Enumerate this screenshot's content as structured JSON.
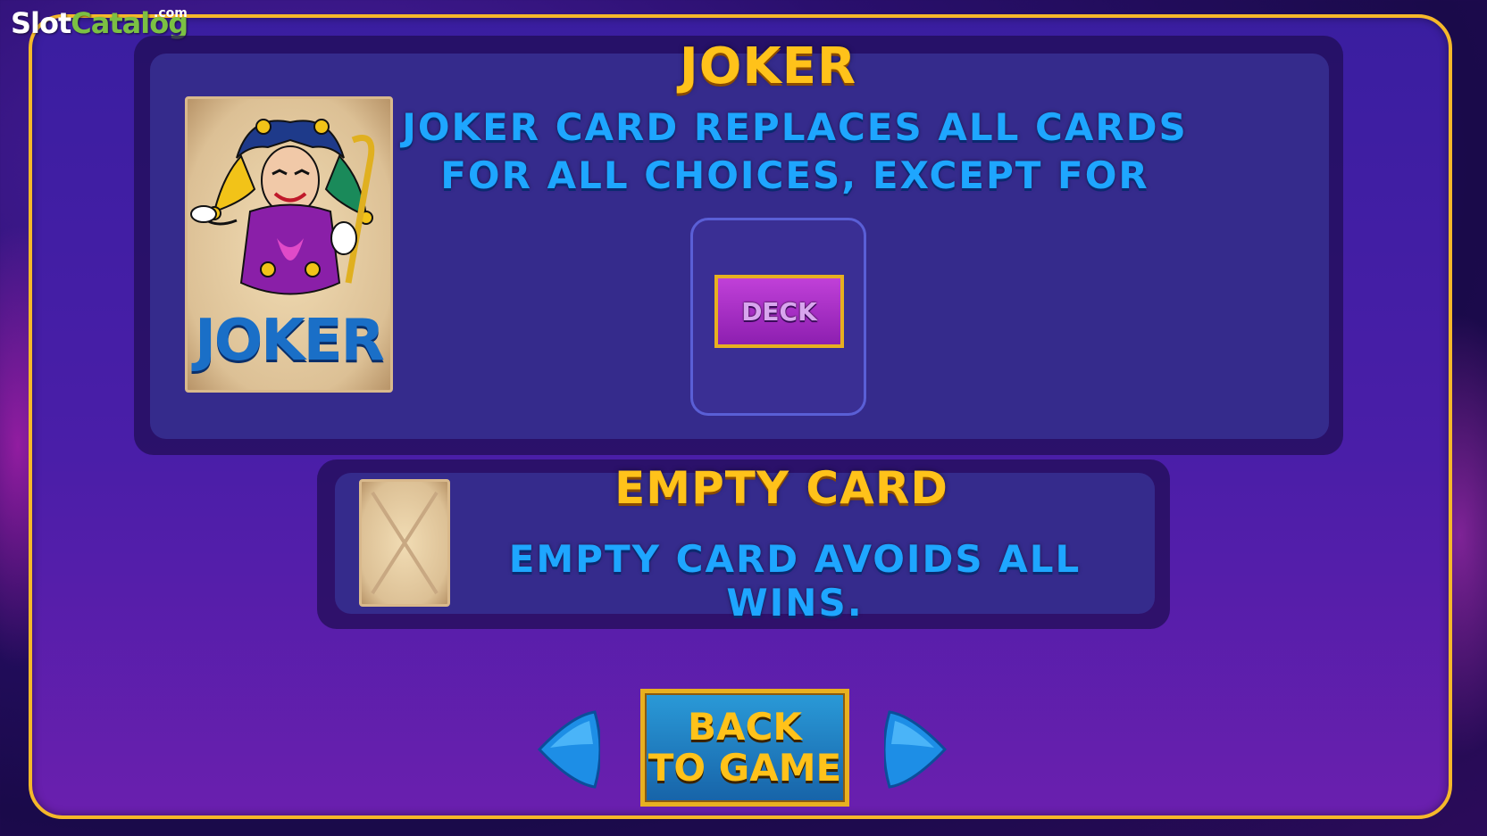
{
  "watermark": {
    "slot": "Slot",
    "catalog": "Catalog",
    "com": ".com"
  },
  "joker_section": {
    "title": "JOKER",
    "description_line1": "JOKER CARD REPLACES ALL CARDS",
    "description_line2": "FOR ALL CHOICES, EXCEPT FOR",
    "card_label": "JOKER",
    "exception_button": "DECK"
  },
  "empty_section": {
    "title": "EMPTY CARD",
    "description": "EMPTY CARD AVOIDS ALL WINS."
  },
  "navigation": {
    "back_line1": "BACK",
    "back_line2": "TO GAME",
    "prev_icon": "arrow-left",
    "next_icon": "arrow-right"
  },
  "colors": {
    "frame_border": "#f5b82a",
    "title": "#ffc21a",
    "description": "#1ea6ff",
    "panel": "#352b8c"
  }
}
